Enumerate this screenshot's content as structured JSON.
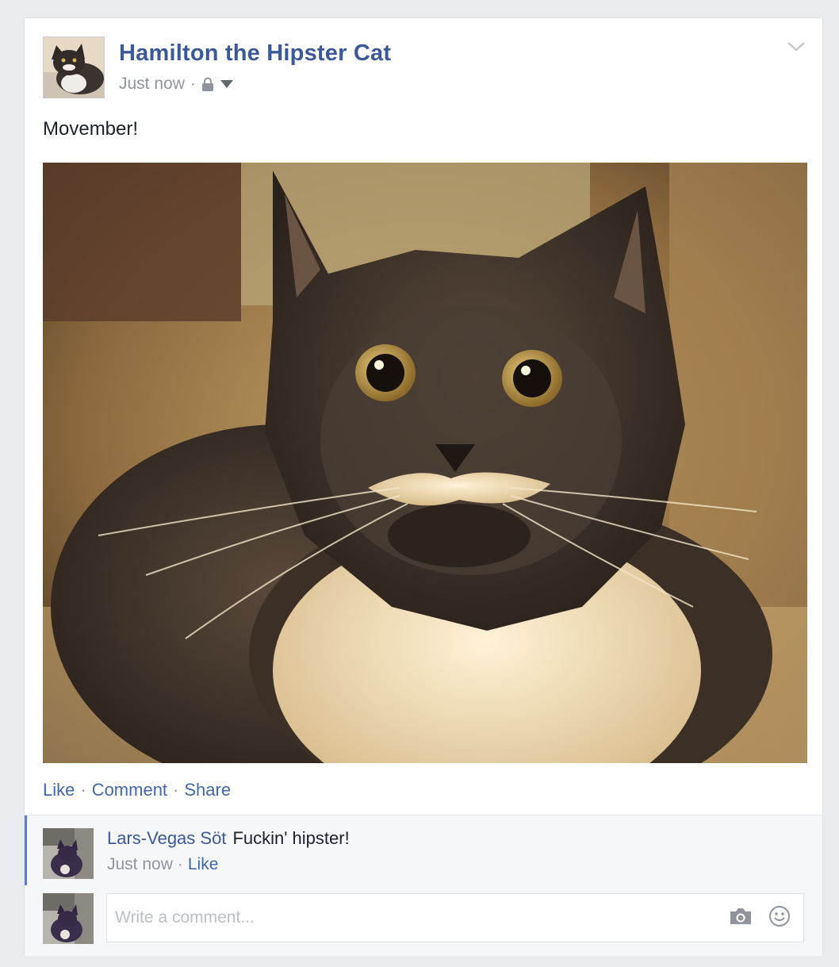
{
  "post": {
    "author": "Hamilton the Hipster Cat",
    "timestamp": "Just now",
    "separator": "·",
    "privacy_icon": "lock-icon",
    "menu_icon": "chevron-down-icon",
    "text": "Movember!"
  },
  "actions": {
    "like": "Like",
    "comment": "Comment",
    "share": "Share",
    "separator": "·"
  },
  "comments": [
    {
      "author": "Lars-Vegas Söt",
      "text": "Fuckin' hipster!",
      "timestamp": "Just now",
      "like": "Like",
      "separator": "·"
    }
  ],
  "composer": {
    "placeholder": "Write a comment...",
    "photo_icon": "camera-icon",
    "emoji_icon": "smiley-icon"
  },
  "colors": {
    "link_blue": "#3b5998",
    "action_blue": "#4267b2",
    "meta_gray": "#90949c",
    "background": "#e9ebee",
    "comment_accent": "#5b7bd5"
  }
}
